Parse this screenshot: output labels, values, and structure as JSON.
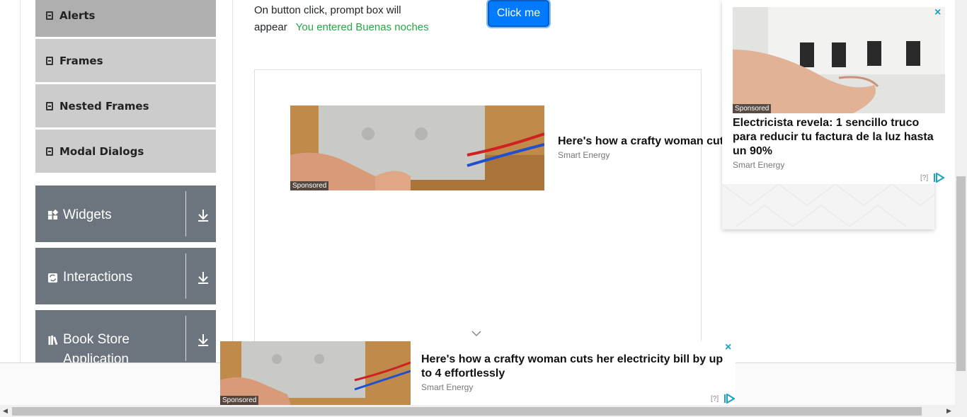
{
  "sidebar": {
    "sub_items": [
      {
        "label": "Alerts",
        "active": true
      },
      {
        "label": "Frames",
        "active": false
      },
      {
        "label": "Nested Frames",
        "active": false
      },
      {
        "label": "Modal Dialogs",
        "active": false
      }
    ],
    "groups": [
      {
        "label": "Widgets",
        "icon": "widgets-icon"
      },
      {
        "label": "Interactions",
        "icon": "interactions-icon"
      },
      {
        "label": "Book Store Application",
        "icon": "book-icon"
      }
    ]
  },
  "main": {
    "prompt_label": "On button click, prompt box will appear",
    "prompt_result": "You entered Buenas noches",
    "button_label": "Click me"
  },
  "ads": {
    "inline": {
      "sponsored": "Sponsored",
      "title": "Here's how a crafty woman cuts",
      "source": "Smart Energy"
    },
    "right": {
      "sponsored": "Sponsored",
      "title": "Electricista revela: 1 sencillo truco para reducir tu factura de la luz hasta un 90%",
      "source": "Smart Energy",
      "adchoices": "[?]",
      "close": "×"
    },
    "bottom": {
      "sponsored": "Sponsored",
      "title": "Here's how a crafty woman cuts her electricity bill by up to 4 effortlessly",
      "source": "Smart Energy",
      "adchoices": "[?]",
      "close": "×"
    }
  },
  "colors": {
    "accent": "#007bff",
    "success_text": "#28a745",
    "sidebar_group": "#6c757d",
    "close_icon": "#1aa3c4"
  }
}
